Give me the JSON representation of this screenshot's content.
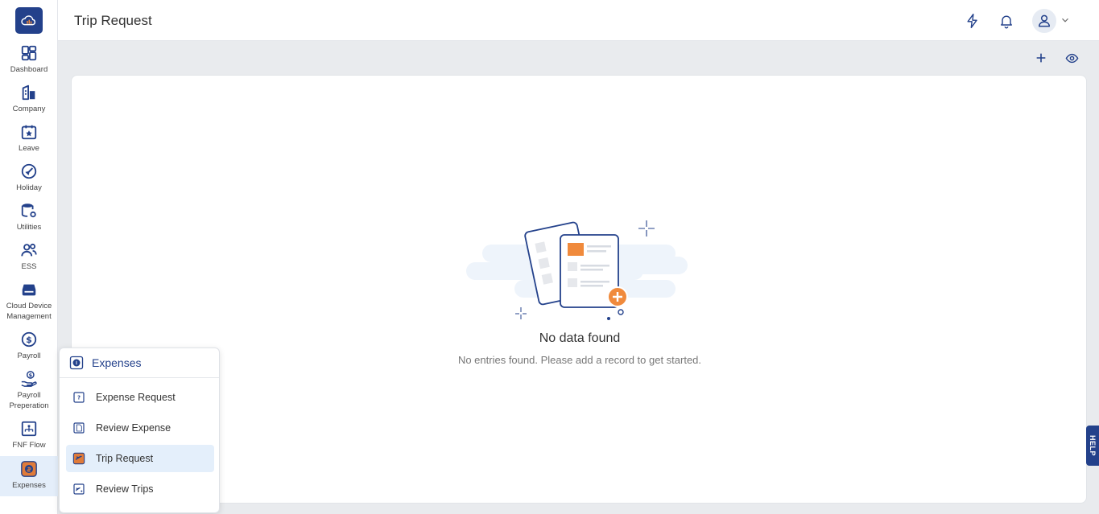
{
  "header": {
    "title": "Trip Request"
  },
  "topbar_icons": [
    "lightning-icon",
    "bell-icon",
    "user-icon",
    "chevron-down-icon"
  ],
  "content_actions": [
    "plus-icon",
    "eye-icon"
  ],
  "sidebar": {
    "items": [
      {
        "label": "Dashboard",
        "icon": "dashboard-icon"
      },
      {
        "label": "Company",
        "icon": "company-icon"
      },
      {
        "label": "Leave",
        "icon": "leave-icon"
      },
      {
        "label": "Holiday",
        "icon": "holiday-icon"
      },
      {
        "label": "Utilities",
        "icon": "utilities-icon"
      },
      {
        "label": "ESS",
        "icon": "ess-icon"
      },
      {
        "label": "Cloud Device Management",
        "icon": "cloud-device-icon"
      },
      {
        "label": "Payroll",
        "icon": "payroll-icon"
      },
      {
        "label": "Payroll Preperation",
        "icon": "payroll-preparation-icon"
      },
      {
        "label": "FNF Flow",
        "icon": "fnf-flow-icon"
      },
      {
        "label": "Expenses",
        "icon": "expenses-icon",
        "active": true
      }
    ]
  },
  "empty_state": {
    "title": "No data found",
    "subtitle": "No entries found. Please add a record to get started."
  },
  "help": {
    "label": "HELP"
  },
  "flyout": {
    "title": "Expenses",
    "items": [
      {
        "label": "Expense Request",
        "icon": "expense-request-icon"
      },
      {
        "label": "Review Expense",
        "icon": "review-expense-icon"
      },
      {
        "label": "Trip Request",
        "icon": "trip-request-icon",
        "active": true
      },
      {
        "label": "Review Trips",
        "icon": "review-trips-icon"
      }
    ]
  },
  "colors": {
    "primary": "#23418b",
    "accent": "#f08a3c",
    "active_bg": "#e4effb"
  }
}
